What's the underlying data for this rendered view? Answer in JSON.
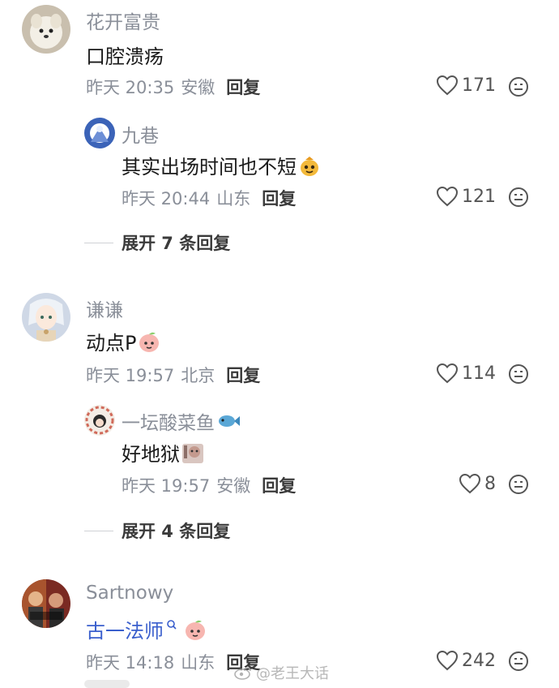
{
  "comments": [
    {
      "user": "花开富贵",
      "text": "口腔溃疡",
      "time": "昨天 20:35",
      "ip": "安徽",
      "reply": "回复",
      "likes": "171",
      "replies": [
        {
          "user": "九巷",
          "text": "其实出场时间也不短",
          "time": "昨天 20:44",
          "ip": "山东",
          "reply": "回复",
          "likes": "121"
        }
      ],
      "expand": "展开 7 条回复"
    },
    {
      "user": "谦谦",
      "text": "动点P",
      "time": "昨天 19:57",
      "ip": "北京",
      "reply": "回复",
      "likes": "114",
      "replies": [
        {
          "user": "一坛酸菜鱼",
          "text": "好地狱",
          "time": "昨天 19:57",
          "ip": "安徽",
          "reply": "回复",
          "likes": "8"
        }
      ],
      "expand": "展开 4 条回复"
    },
    {
      "user": "Sartnowy",
      "text": "古一法师",
      "time": "昨天 14:18",
      "ip": "山东",
      "reply": "回复",
      "likes": "242"
    }
  ],
  "watermark": "@老王大话",
  "icons": {
    "like": "heart-outline-icon",
    "dislike": "meh-face-icon"
  },
  "colors": {
    "meta": "#8a8f99",
    "link": "#3a5fcd"
  }
}
